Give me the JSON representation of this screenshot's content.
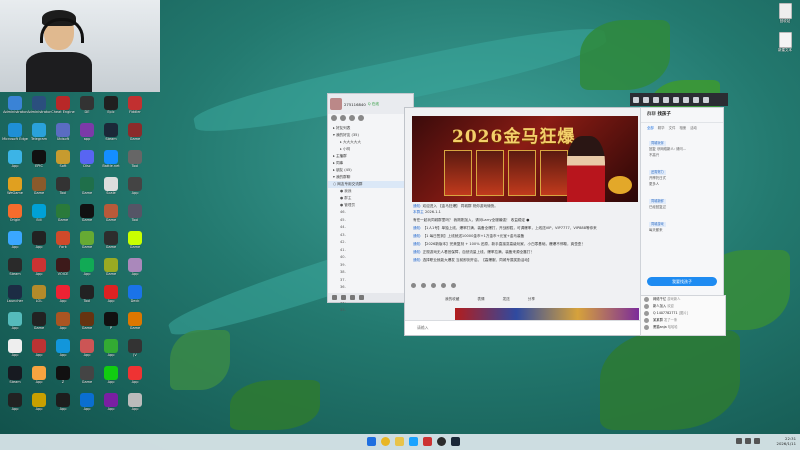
{
  "desktop": {
    "icons": [
      {
        "label": "Administrator",
        "color": "#3a83d6"
      },
      {
        "label": "Administrator",
        "color": "#2b4f7e"
      },
      {
        "label": "Cheat Engine",
        "color": "#b82828"
      },
      {
        "label": "DE",
        "color": "#333"
      },
      {
        "label": "Epic",
        "color": "#202020"
      },
      {
        "label": "Fiddler",
        "color": "#c23030"
      },
      {
        "label": "Microsoft Edge",
        "color": "#1f8fd6"
      },
      {
        "label": "Telegram",
        "color": "#2aa1da"
      },
      {
        "label": "Ubisoft",
        "color": "#5a6cc2"
      },
      {
        "label": "app",
        "color": "#7c3aa8"
      },
      {
        "label": "Steam",
        "color": "#1b2838"
      },
      {
        "label": "Game",
        "color": "#8b2b2b"
      },
      {
        "label": "App",
        "color": "#3cb4e6"
      },
      {
        "label": "EPIC",
        "color": "#111"
      },
      {
        "label": "Soft",
        "color": "#c79b2f"
      },
      {
        "label": "Disc",
        "color": "#5865f2"
      },
      {
        "label": "Battle.net",
        "color": "#148eff"
      },
      {
        "label": "Tool",
        "color": "#666"
      },
      {
        "label": "WeGame",
        "color": "#e0a020"
      },
      {
        "label": "Game",
        "color": "#8a5a2b"
      },
      {
        "label": "Tool",
        "color": "#333"
      },
      {
        "label": "Game",
        "color": "#1f6f4a"
      },
      {
        "label": "Scale",
        "color": "#ddd"
      },
      {
        "label": "App",
        "color": "#444"
      },
      {
        "label": "Origin",
        "color": "#f56c2d"
      },
      {
        "label": "Bili",
        "color": "#00a1d6"
      },
      {
        "label": "Game",
        "color": "#2a7a3a"
      },
      {
        "label": "Game",
        "color": "#111"
      },
      {
        "label": "Game",
        "color": "#b85a3a"
      },
      {
        "label": "Tool",
        "color": "#556"
      },
      {
        "label": "App",
        "color": "#3aa7ff"
      },
      {
        "label": "App",
        "color": "#222"
      },
      {
        "label": "Fork",
        "color": "#d04a2a"
      },
      {
        "label": "Game",
        "color": "#6a3"
      },
      {
        "label": "Game",
        "color": "#2d2d2d"
      },
      {
        "label": "Game",
        "color": "#c8ff00"
      },
      {
        "label": "Steam",
        "color": "#2a2a2a"
      },
      {
        "label": "App",
        "color": "#c33"
      },
      {
        "label": "VOICE",
        "color": "#3d1a1a"
      },
      {
        "label": "App",
        "color": "#1a5"
      },
      {
        "label": "Game",
        "color": "#9a2"
      },
      {
        "label": "App",
        "color": "#a8b"
      },
      {
        "label": "Launcher",
        "color": "#1c2c44"
      },
      {
        "label": "LOL",
        "color": "#b38b2a"
      },
      {
        "label": "App",
        "color": "#e23"
      },
      {
        "label": "Tool",
        "color": "#222"
      },
      {
        "label": "App",
        "color": "#d22"
      },
      {
        "label": "Deck",
        "color": "#1a73e8"
      },
      {
        "label": "App",
        "color": "#5bb"
      },
      {
        "label": "Game",
        "color": "#222"
      },
      {
        "label": "App",
        "color": "#a52"
      },
      {
        "label": "Game",
        "color": "#631"
      },
      {
        "label": "P",
        "color": "#111"
      },
      {
        "label": "Game",
        "color": "#d70"
      },
      {
        "label": "App",
        "color": "#eee"
      },
      {
        "label": "App",
        "color": "#b33"
      },
      {
        "label": "App",
        "color": "#1296db"
      },
      {
        "label": "App",
        "color": "#c55"
      },
      {
        "label": "App",
        "color": "#3a3"
      },
      {
        "label": "JV",
        "color": "#333"
      },
      {
        "label": "Steam",
        "color": "#171a21"
      },
      {
        "label": "App",
        "color": "#f7a440"
      },
      {
        "label": "Z",
        "color": "#111"
      },
      {
        "label": "Game",
        "color": "#444"
      },
      {
        "label": "App",
        "color": "#1c1"
      },
      {
        "label": "App",
        "color": "#e33"
      },
      {
        "label": "App",
        "color": "#222"
      },
      {
        "label": "App",
        "color": "#c8a000"
      },
      {
        "label": "App",
        "color": "#1d1d1d"
      },
      {
        "label": "App",
        "color": "#0a6ed1"
      },
      {
        "label": "App",
        "color": "#7a1fa2"
      },
      {
        "label": "App",
        "color": "#bbb"
      }
    ],
    "right_icons": [
      {
        "label": "回收站"
      },
      {
        "label": "新建文本"
      }
    ]
  },
  "qq_main": {
    "id_label": "275116840",
    "status": "Q 在线",
    "groups": [
      {
        "label": "▸ 好友列表"
      },
      {
        "label": "▾ 我的好友 (35)"
      },
      {
        "label": "▸ 大大大大大"
      },
      {
        "label": "▸ 小明"
      },
      {
        "label": "▸ 主播群"
      },
      {
        "label": "▸ 同事"
      },
      {
        "label": "▸ 朋友 (45)"
      },
      {
        "label": "▾ 我的群聊"
      }
    ],
    "highlight_group": "○ 网友专用交流群",
    "sub_items": [
      "● 我我",
      "● 群主",
      "● 管理员"
    ],
    "numbered": [
      "46.",
      "45.",
      "44.",
      "43.",
      "42.",
      "41.",
      "40.",
      "39.",
      "38.",
      "37.",
      "36.",
      "35.",
      "34.",
      "33."
    ]
  },
  "chat": {
    "banner_title": "2026金马狂爆",
    "messages": [
      {
        "who": "通知:",
        "text": "欢迎进入 【金马狂爆】 同城群 祝你游戏愉快。"
      },
      {
        "who": "本群主",
        "text": "2026.1.1"
      },
      {
        "who": "",
        "text": "有任一起玩同城群里吗？ 我刚刚加入，请问Larry全服最强！ 收益稳定 ●"
      },
      {
        "who": "通知:",
        "text": "【1人1号】单独上线，爆率打满，装备全爆打，开战即胜，可调爆率，上线送VIP，VIP7777，VIP888等你来"
      },
      {
        "who": "通知:",
        "text": "【1 每日签到】上线就送10000金币+1万金币+元宝+金马装备"
      },
      {
        "who": "通知:",
        "text": "【2026新版本】完美复刻 + 100% 还原，新手直接变高级玩家，小白零基础，爆爆不停歇，爽歪歪！"
      },
      {
        "who": "通知:",
        "text": "正规游戏无人看官保障，自然流量上线，爆率拉满，装备来源全靠打！"
      },
      {
        "who": "通知:",
        "text": "选择职业就能大爆发 当前即刻开启，【高爆服、同城专属奖励活动】"
      }
    ],
    "lower_tabs": [
      "我的收藏",
      "表情",
      "发送",
      "分享"
    ],
    "compose_placeholder": "请输入"
  },
  "side_panel": {
    "header_prefix": "群聊",
    "header_title": "找孩子",
    "tabs": [
      "全部",
      "精华",
      "文件",
      "相册",
      "活动"
    ],
    "lines": [
      "回复 @网络新人: 请问...",
      "不高兴",
      "开摩托日式",
      "更多人",
      "已经回复过",
      "每天都来"
    ],
    "tags": [
      "同城玩伴",
      "还需努力",
      "同城新鲜",
      "同城游戏"
    ],
    "button": "我要找孩子"
  },
  "chat_list": {
    "rows": [
      {
        "name": "网络千亿",
        "msg": "游戏新人"
      },
      {
        "name": "新人加入",
        "msg": "欢迎"
      },
      {
        "name": "Q 1407782771",
        "msg": "[图片]"
      },
      {
        "name": "某某群",
        "msg": "发了一条"
      },
      {
        "name": "黑猫anja",
        "msg": "哈哈哈"
      }
    ]
  },
  "taskbar": {
    "time": "22:31",
    "date": "2026/1/11",
    "apps": [
      "start",
      "search",
      "chrome",
      "explorer",
      "qq",
      "obs",
      "app",
      "steam"
    ]
  },
  "colors": {
    "accent": "#1e8bf1",
    "desktop": "#23796f"
  }
}
